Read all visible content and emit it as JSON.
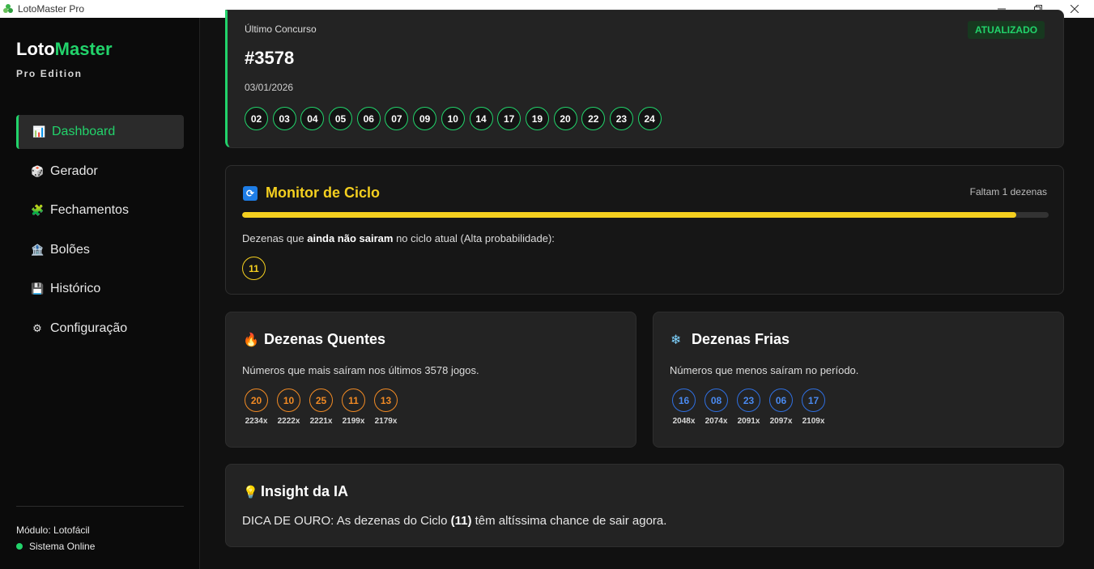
{
  "window": {
    "title": "LotoMaster Pro"
  },
  "brand": {
    "name_part1": "Loto",
    "name_part2": "Master",
    "edition": "Pro Edition"
  },
  "nav": {
    "items": [
      {
        "label": "Dashboard",
        "icon": "bar-chart-icon",
        "glyph": "📊",
        "active": true
      },
      {
        "label": "Gerador",
        "icon": "dice-icon",
        "glyph": "🎲"
      },
      {
        "label": "Fechamentos",
        "icon": "puzzle-icon",
        "glyph": "🧩"
      },
      {
        "label": "Bolões",
        "icon": "bank-icon",
        "glyph": "🏦"
      },
      {
        "label": "Histórico",
        "icon": "floppy-icon",
        "glyph": "💾"
      },
      {
        "label": "Configuração",
        "icon": "gear-icon",
        "glyph": "⚙"
      }
    ]
  },
  "status": {
    "module": "Módulo: Lotofácil",
    "online": "Sistema Online"
  },
  "last_draw": {
    "label": "Último Concurso",
    "number": "#3578",
    "date": "03/01/2026",
    "badge": "ATUALIZADO",
    "balls": [
      "02",
      "03",
      "04",
      "05",
      "06",
      "07",
      "09",
      "10",
      "14",
      "17",
      "19",
      "20",
      "22",
      "23",
      "24"
    ]
  },
  "cycle": {
    "title": "Monitor de Ciclo",
    "remaining": "Faltam 1 dezenas",
    "progress_percent": 96,
    "desc_pre": "Dezenas que ",
    "desc_bold": "ainda não sairam",
    "desc_post": " no ciclo atual (Alta probabilidade):",
    "balls": [
      "11"
    ]
  },
  "hot": {
    "title": "Dezenas Quentes",
    "desc": "Números que mais saíram nos últimos 3578 jogos.",
    "items": [
      {
        "n": "20",
        "count": "2234x"
      },
      {
        "n": "10",
        "count": "2222x"
      },
      {
        "n": "25",
        "count": "2221x"
      },
      {
        "n": "11",
        "count": "2199x"
      },
      {
        "n": "13",
        "count": "2179x"
      }
    ]
  },
  "cold": {
    "title": "Dezenas Frias",
    "desc": "Números que menos saíram no período.",
    "items": [
      {
        "n": "16",
        "count": "2048x"
      },
      {
        "n": "08",
        "count": "2074x"
      },
      {
        "n": "23",
        "count": "2091x"
      },
      {
        "n": "06",
        "count": "2097x"
      },
      {
        "n": "17",
        "count": "2109x"
      }
    ]
  },
  "insight": {
    "title": "Insight da IA",
    "text_pre": "DICA DE OURO: As dezenas do Ciclo ",
    "text_bold": "(11)",
    "text_post": " têm altíssima chance de sair agora."
  },
  "colors": {
    "accent": "#22d36b",
    "yellow": "#f4cf1f",
    "orange": "#f08a24",
    "blue": "#2f6fe0"
  }
}
